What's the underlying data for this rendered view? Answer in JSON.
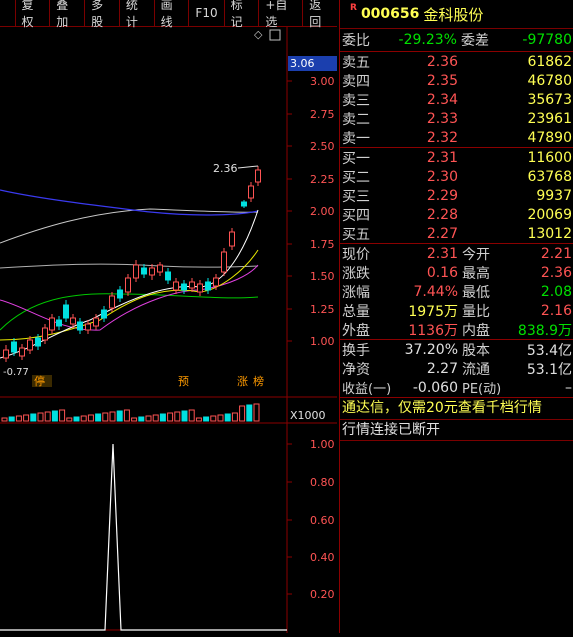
{
  "toolbar": {
    "buttons": [
      "复权",
      "叠加",
      "多股",
      "统计",
      "画线",
      "F10",
      "标记",
      "+自选",
      "返回"
    ]
  },
  "chart": {
    "price_axis": [
      "3.00",
      "2.75",
      "2.50",
      "2.25",
      "2.00",
      "1.75",
      "1.50",
      "1.25",
      "1.00"
    ],
    "current_price_tag": "3.06",
    "high_label": "2.36",
    "low_label": "0.77",
    "events": [
      "停",
      "预",
      "涨",
      "榜"
    ],
    "volume_multiplier": "X1000",
    "indicator_axis": [
      "1.00",
      "0.80",
      "0.60",
      "0.40",
      "0.20"
    ]
  },
  "quote": {
    "r_mark": "R",
    "code": "000656",
    "name": "金科股份",
    "weibi_label": "委比",
    "weibi": "-29.23%",
    "weicha_label": "委差",
    "weicha": "-97780",
    "asks": [
      {
        "label": "卖五",
        "price": "2.36",
        "vol": "61862"
      },
      {
        "label": "卖四",
        "price": "2.35",
        "vol": "46780"
      },
      {
        "label": "卖三",
        "price": "2.34",
        "vol": "35673"
      },
      {
        "label": "卖二",
        "price": "2.33",
        "vol": "23961"
      },
      {
        "label": "卖一",
        "price": "2.32",
        "vol": "47890"
      }
    ],
    "bids": [
      {
        "label": "买一",
        "price": "2.31",
        "vol": "11600"
      },
      {
        "label": "买二",
        "price": "2.30",
        "vol": "63768"
      },
      {
        "label": "买三",
        "price": "2.29",
        "vol": "9937"
      },
      {
        "label": "买四",
        "price": "2.28",
        "vol": "20069"
      },
      {
        "label": "买五",
        "price": "2.27",
        "vol": "13012"
      }
    ],
    "stats1": [
      {
        "l1": "现价",
        "v1": "2.31",
        "l2": "今开",
        "v2": "2.21"
      },
      {
        "l1": "涨跌",
        "v1": "0.16",
        "l2": "最高",
        "v2": "2.36"
      },
      {
        "l1": "涨幅",
        "v1": "7.44%",
        "l2": "最低",
        "v2": "2.08"
      },
      {
        "l1": "总量",
        "v1": "1975万",
        "l2": "量比",
        "v2": "2.16"
      },
      {
        "l1": "外盘",
        "v1": "1136万",
        "l2": "内盘",
        "v2": "838.9万"
      }
    ],
    "stats2": [
      {
        "l1": "换手",
        "v1": "37.20%",
        "l2": "股本",
        "v2": "53.4亿"
      },
      {
        "l1": "净资",
        "v1": "2.27",
        "l2": "流通",
        "v2": "53.1亿"
      },
      {
        "l1": "收益(一)",
        "v1": "-0.060",
        "l2": "PE(动)",
        "v2": "–"
      }
    ],
    "notice": "通达信，仅需20元查看千档行情",
    "status": "行情连接已断开"
  },
  "colors": {
    "up": "#ff5454",
    "down": "#00e000",
    "text_yellow": "#ffff54",
    "border": "#8b0000"
  }
}
